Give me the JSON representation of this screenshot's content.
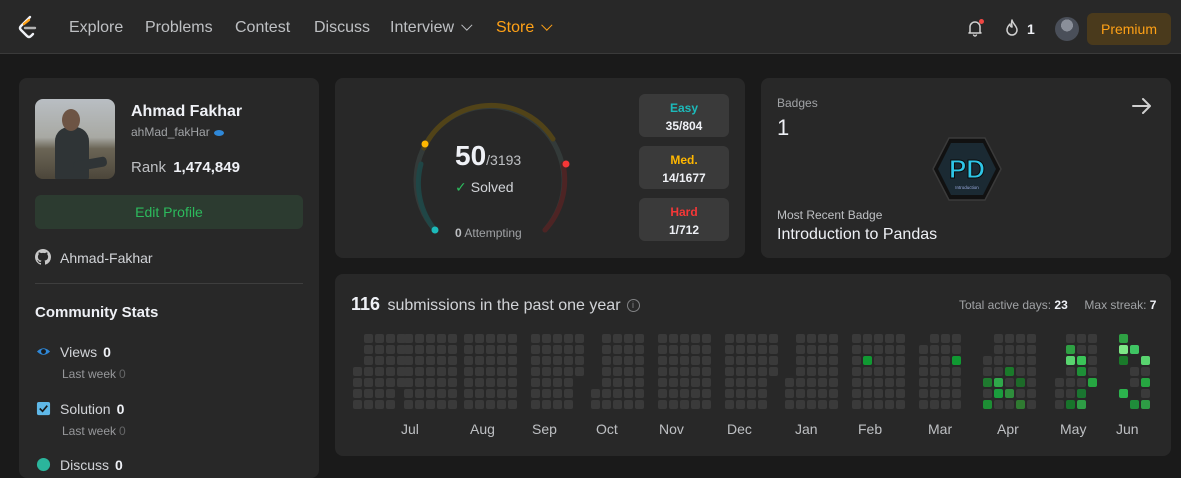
{
  "nav": {
    "items": [
      "Explore",
      "Problems",
      "Contest",
      "Discuss"
    ],
    "interview": "Interview",
    "store": "Store",
    "streak": "1",
    "premium": "Premium"
  },
  "profile": {
    "name": "Ahmad Fakhar",
    "username": "ahMad_fakHar",
    "rank_label": "Rank",
    "rank": "1,474,849",
    "edit": "Edit Profile",
    "github": "Ahmad-Fakhar",
    "community_title": "Community Stats",
    "stats": [
      {
        "label": "Views",
        "value": "0",
        "sub": "Last week",
        "sub_value": "0"
      },
      {
        "label": "Solution",
        "value": "0",
        "sub": "Last week",
        "sub_value": "0"
      },
      {
        "label": "Discuss",
        "value": "0"
      }
    ]
  },
  "solved": {
    "count": "50",
    "total": "/3193",
    "label": "Solved",
    "attempting": "0",
    "attempting_label": "Attempting",
    "difficulties": [
      {
        "label": "Easy",
        "value": "35/804",
        "color": "#1cbaba"
      },
      {
        "label": "Med.",
        "value": "14/1677",
        "color": "#ffb700"
      },
      {
        "label": "Hard",
        "value": "1/712",
        "color": "#f63737"
      }
    ]
  },
  "badges": {
    "title": "Badges",
    "count": "1",
    "badge_text": "PD",
    "badge_subtext": "Introduction",
    "recent_label": "Most Recent Badge",
    "recent_name": "Introduction to Pandas"
  },
  "calendar": {
    "count": "116",
    "text": "submissions in the past one year",
    "active_label": "Total active days:",
    "active_days": "23",
    "streak_label": "Max streak:",
    "max_streak": "7",
    "months": [
      "Jul",
      "Aug",
      "Sep",
      "Oct",
      "Nov",
      "Dec",
      "Jan",
      "Feb",
      "Mar",
      "Apr",
      "May",
      "Jun"
    ]
  }
}
